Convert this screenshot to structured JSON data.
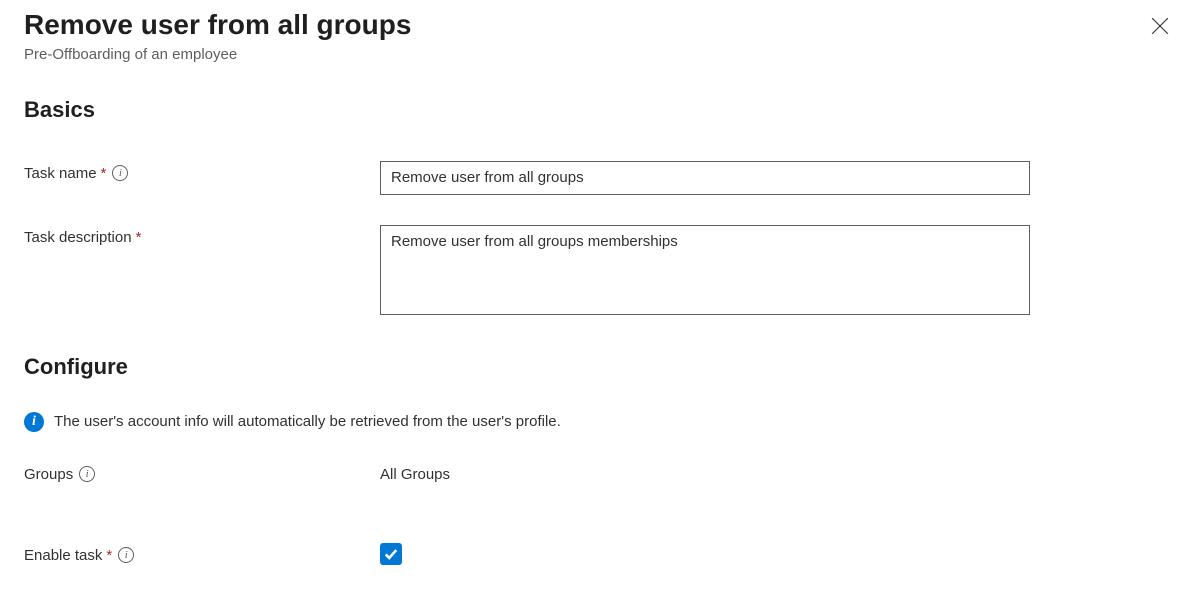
{
  "header": {
    "title": "Remove user from all groups",
    "subtitle": "Pre-Offboarding of an employee"
  },
  "sections": {
    "basics": "Basics",
    "configure": "Configure"
  },
  "fields": {
    "task_name": {
      "label": "Task name",
      "value": "Remove user from all groups",
      "required": true,
      "has_info": true
    },
    "task_description": {
      "label": "Task description",
      "value": "Remove user from all groups memberships",
      "required": true,
      "has_info": false
    },
    "groups": {
      "label": "Groups",
      "value": "All Groups",
      "required": false,
      "has_info": true
    },
    "enable_task": {
      "label": "Enable task",
      "checked": true,
      "required": true,
      "has_info": true
    }
  },
  "info_message": "The user's account info will automatically be retrieved from the user's profile.",
  "required_marker": "*",
  "info_glyph": "i"
}
